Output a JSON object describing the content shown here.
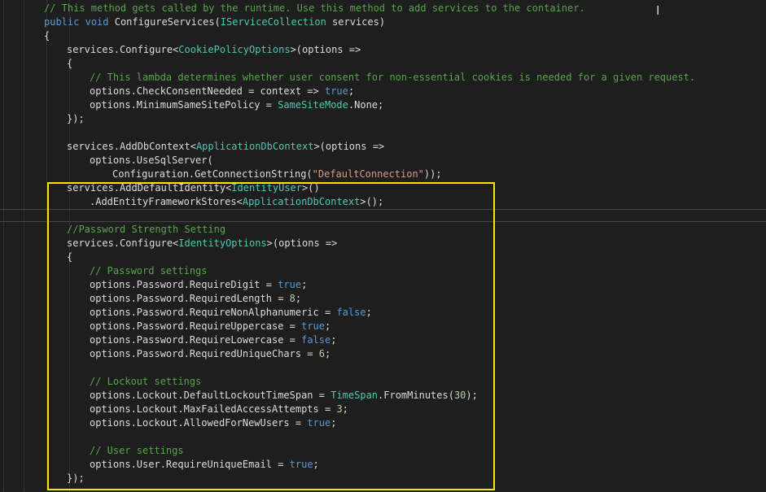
{
  "editor": {
    "theme_colors": {
      "background": "#1e1e1e",
      "text": "#dcdcdc",
      "keyword": "#569cd6",
      "type": "#4ec9b0",
      "comment": "#57a64a",
      "string": "#d69d85",
      "number": "#b5cea8",
      "highlight_box": "#ffe600"
    },
    "cursor_icon": "text-ibeam-icon",
    "cursor_glyph": "I",
    "lines": [
      {
        "indent": 0,
        "tokens": [
          {
            "t": "cm",
            "v": "// This method gets called by the runtime. Use this method to add services to the container."
          }
        ]
      },
      {
        "indent": 0,
        "tokens": [
          {
            "t": "kw",
            "v": "public"
          },
          {
            "t": "txt",
            "v": " "
          },
          {
            "t": "kw",
            "v": "void"
          },
          {
            "t": "txt",
            "v": " ConfigureServices("
          },
          {
            "t": "type",
            "v": "IServiceCollection"
          },
          {
            "t": "txt",
            "v": " services)"
          }
        ]
      },
      {
        "indent": 0,
        "tokens": [
          {
            "t": "txt",
            "v": "{"
          }
        ]
      },
      {
        "indent": 1,
        "tokens": [
          {
            "t": "txt",
            "v": "services.Configure<"
          },
          {
            "t": "type",
            "v": "CookiePolicyOptions"
          },
          {
            "t": "txt",
            "v": ">(options =>"
          }
        ]
      },
      {
        "indent": 1,
        "tokens": [
          {
            "t": "txt",
            "v": "{"
          }
        ]
      },
      {
        "indent": 2,
        "tokens": [
          {
            "t": "cm",
            "v": "// This lambda determines whether user consent for non-essential cookies is needed for a given request."
          }
        ]
      },
      {
        "indent": 2,
        "tokens": [
          {
            "t": "txt",
            "v": "options.CheckConsentNeeded = context => "
          },
          {
            "t": "kw",
            "v": "true"
          },
          {
            "t": "txt",
            "v": ";"
          }
        ]
      },
      {
        "indent": 2,
        "tokens": [
          {
            "t": "txt",
            "v": "options.MinimumSameSitePolicy = "
          },
          {
            "t": "type",
            "v": "SameSiteMode"
          },
          {
            "t": "txt",
            "v": ".None;"
          }
        ]
      },
      {
        "indent": 1,
        "tokens": [
          {
            "t": "txt",
            "v": "});"
          }
        ]
      },
      {
        "indent": 0,
        "tokens": []
      },
      {
        "indent": 1,
        "tokens": [
          {
            "t": "txt",
            "v": "services.AddDbContext<"
          },
          {
            "t": "type",
            "v": "ApplicationDbContext"
          },
          {
            "t": "txt",
            "v": ">(options =>"
          }
        ]
      },
      {
        "indent": 2,
        "tokens": [
          {
            "t": "txt",
            "v": "options.UseSqlServer("
          }
        ]
      },
      {
        "indent": 3,
        "tokens": [
          {
            "t": "txt",
            "v": "Configuration.GetConnectionString("
          },
          {
            "t": "str",
            "v": "\"DefaultConnection\""
          },
          {
            "t": "txt",
            "v": "));"
          }
        ]
      },
      {
        "indent": 1,
        "tokens": [
          {
            "t": "txt",
            "v": "services.AddDefaultIdentity<"
          },
          {
            "t": "type",
            "v": "IdentityUser"
          },
          {
            "t": "txt",
            "v": ">()"
          }
        ]
      },
      {
        "indent": 2,
        "tokens": [
          {
            "t": "txt",
            "v": ".AddEntityFrameworkStores<"
          },
          {
            "t": "type",
            "v": "ApplicationDbContext"
          },
          {
            "t": "txt",
            "v": ">();"
          }
        ]
      },
      {
        "indent": 0,
        "tokens": []
      },
      {
        "indent": 1,
        "tokens": [
          {
            "t": "cm",
            "v": "//Password Strength Setting"
          }
        ]
      },
      {
        "indent": 1,
        "tokens": [
          {
            "t": "txt",
            "v": "services.Configure<"
          },
          {
            "t": "type",
            "v": "IdentityOptions"
          },
          {
            "t": "txt",
            "v": ">(options =>"
          }
        ]
      },
      {
        "indent": 1,
        "tokens": [
          {
            "t": "txt",
            "v": "{"
          }
        ]
      },
      {
        "indent": 2,
        "tokens": [
          {
            "t": "cm",
            "v": "// Password settings"
          }
        ]
      },
      {
        "indent": 2,
        "tokens": [
          {
            "t": "txt",
            "v": "options.Password.RequireDigit = "
          },
          {
            "t": "kw",
            "v": "true"
          },
          {
            "t": "txt",
            "v": ";"
          }
        ]
      },
      {
        "indent": 2,
        "tokens": [
          {
            "t": "txt",
            "v": "options.Password.RequiredLength = "
          },
          {
            "t": "num",
            "v": "8"
          },
          {
            "t": "txt",
            "v": ";"
          }
        ]
      },
      {
        "indent": 2,
        "tokens": [
          {
            "t": "txt",
            "v": "options.Password.RequireNonAlphanumeric = "
          },
          {
            "t": "kw",
            "v": "false"
          },
          {
            "t": "txt",
            "v": ";"
          }
        ]
      },
      {
        "indent": 2,
        "tokens": [
          {
            "t": "txt",
            "v": "options.Password.RequireUppercase = "
          },
          {
            "t": "kw",
            "v": "true"
          },
          {
            "t": "txt",
            "v": ";"
          }
        ]
      },
      {
        "indent": 2,
        "tokens": [
          {
            "t": "txt",
            "v": "options.Password.RequireLowercase = "
          },
          {
            "t": "kw",
            "v": "false"
          },
          {
            "t": "txt",
            "v": ";"
          }
        ]
      },
      {
        "indent": 2,
        "tokens": [
          {
            "t": "txt",
            "v": "options.Password.RequiredUniqueChars = "
          },
          {
            "t": "num",
            "v": "6"
          },
          {
            "t": "txt",
            "v": ";"
          }
        ]
      },
      {
        "indent": 0,
        "tokens": []
      },
      {
        "indent": 2,
        "tokens": [
          {
            "t": "cm",
            "v": "// Lockout settings"
          }
        ]
      },
      {
        "indent": 2,
        "tokens": [
          {
            "t": "txt",
            "v": "options.Lockout.DefaultLockoutTimeSpan = "
          },
          {
            "t": "type",
            "v": "TimeSpan"
          },
          {
            "t": "txt",
            "v": ".FromMinutes("
          },
          {
            "t": "num",
            "v": "30"
          },
          {
            "t": "txt",
            "v": ");"
          }
        ]
      },
      {
        "indent": 2,
        "tokens": [
          {
            "t": "txt",
            "v": "options.Lockout.MaxFailedAccessAttempts = "
          },
          {
            "t": "num",
            "v": "3"
          },
          {
            "t": "txt",
            "v": ";"
          }
        ]
      },
      {
        "indent": 2,
        "tokens": [
          {
            "t": "txt",
            "v": "options.Lockout.AllowedForNewUsers = "
          },
          {
            "t": "kw",
            "v": "true"
          },
          {
            "t": "txt",
            "v": ";"
          }
        ]
      },
      {
        "indent": 0,
        "tokens": []
      },
      {
        "indent": 2,
        "tokens": [
          {
            "t": "cm",
            "v": "// User settings"
          }
        ]
      },
      {
        "indent": 2,
        "tokens": [
          {
            "t": "txt",
            "v": "options.User.RequireUniqueEmail = "
          },
          {
            "t": "kw",
            "v": "true"
          },
          {
            "t": "txt",
            "v": ";"
          }
        ]
      },
      {
        "indent": 1,
        "tokens": [
          {
            "t": "txt",
            "v": "});"
          }
        ]
      }
    ]
  }
}
